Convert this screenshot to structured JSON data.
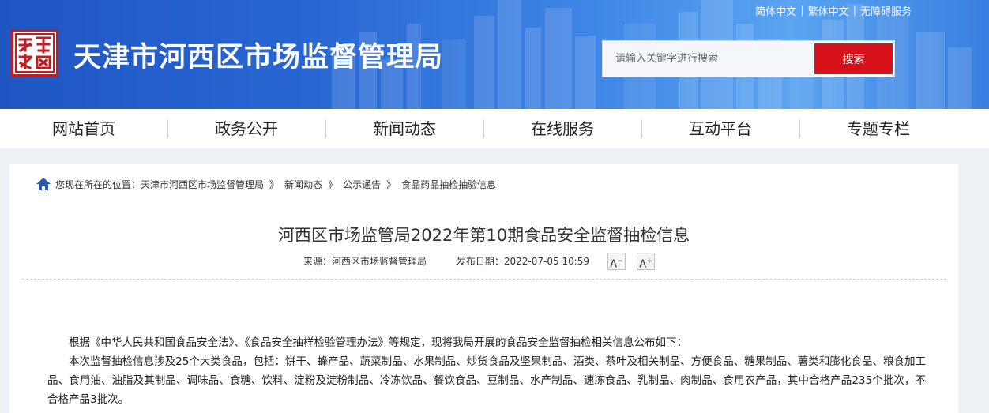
{
  "header": {
    "site_title": "天津市河西区市场监督管理局",
    "lang_links": [
      "简体中文",
      "繁体中文",
      "无障碍服务"
    ],
    "lang_separator": "|",
    "search": {
      "placeholder": "请输入关键字进行搜索",
      "button_label": "搜索"
    },
    "colors": {
      "banner": "#2a6bd4",
      "search_button": "#d7121b",
      "logo_red": "#c71a20"
    }
  },
  "nav": {
    "items": [
      "网站首页",
      "政务公开",
      "新闻动态",
      "在线服务",
      "互动平台",
      "专题专栏"
    ]
  },
  "breadcrumb": {
    "prefix": "您现在所在的位置：",
    "items": [
      "天津市河西区市场监督管理局",
      "新闻动态",
      "公示通告",
      "食品药品抽检抽验信息"
    ],
    "separator": "》"
  },
  "article": {
    "title": "河西区市场监管局2022年第10期食品安全监督抽检信息",
    "source_label": "来源：",
    "source": "河西区市场监督管理局",
    "date_label": "发布日期：",
    "date": "2022-07-05 10:59",
    "font_decrease": "A",
    "font_increase": "A",
    "paragraphs": [
      "根据《中华人民共和国食品安全法》、《食品安全抽样检验管理办法》等规定，现将我局开展的食品安全监督抽检相关信息公布如下：",
      "本次监督抽检信息涉及25个大类食品，包括：饼干、蜂产品、蔬菜制品、水果制品、炒货食品及坚果制品、酒类、茶叶及相关制品、方便食品、糖果制品、薯类和膨化食品、粮食加工品、食用油、油脂及其制品、调味品、食糖、饮料、淀粉及淀粉制品、冷冻饮品、餐饮食品、豆制品、水产制品、速冻食品、乳制品、肉制品、食用农产品，其中合格产品235个批次，不合格产品3批次。"
    ]
  }
}
